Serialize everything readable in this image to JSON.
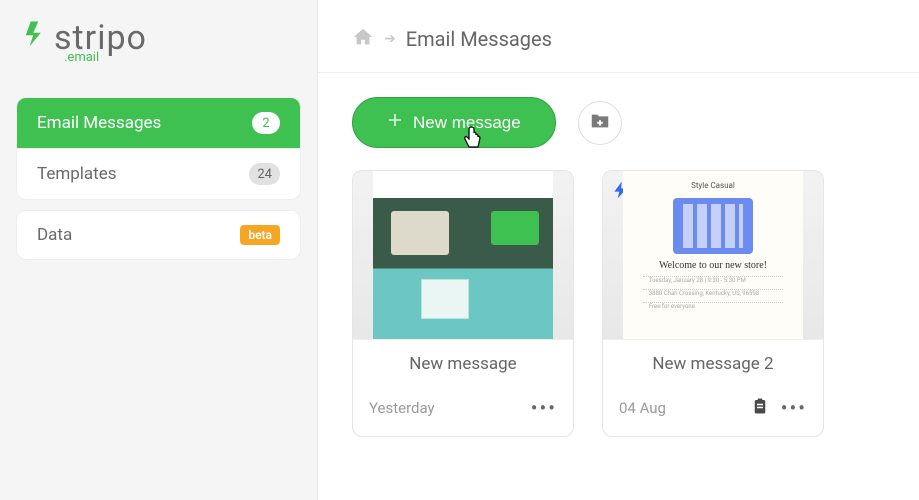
{
  "brand": {
    "name": "stripo",
    "suffix": ".email"
  },
  "sidebar": {
    "groups": [
      {
        "items": [
          {
            "label": "Email Messages",
            "count": "2",
            "active": true
          },
          {
            "label": "Templates",
            "count": "24",
            "active": false
          }
        ]
      },
      {
        "items": [
          {
            "label": "Data",
            "tag": "beta",
            "active": false
          }
        ]
      }
    ]
  },
  "breadcrumb": {
    "current": "Email Messages"
  },
  "toolbar": {
    "new_label": "New message"
  },
  "cards": [
    {
      "title": "New message",
      "date": "Yesterday",
      "has_clipboard": false,
      "has_bolt": false,
      "preview_script": "",
      "preview_lines": []
    },
    {
      "title": "New message 2",
      "date": "04 Aug",
      "has_clipboard": true,
      "has_bolt": true,
      "preview_brand": "Style Casual",
      "preview_script": "Welcome to our new store!",
      "preview_lines": [
        "Tuesday, January 28 | 9:30 - 5:30 PM",
        "3880 Chan Crossing, Kentucky, US, 96598",
        "Free for everyone"
      ]
    }
  ],
  "colors": {
    "accent": "#3fc151",
    "beta": "#f5a623",
    "bolt": "#2d6af2"
  }
}
